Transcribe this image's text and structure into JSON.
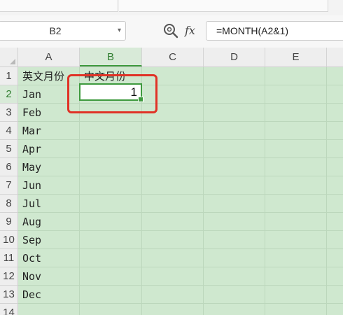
{
  "formula_bar": {
    "name_box": "B2",
    "name_box_arrow": "▾",
    "fx_label": "fx",
    "formula": "=MONTH(A2&1)"
  },
  "grid": {
    "columns": [
      "A",
      "B",
      "C",
      "D",
      "E"
    ],
    "active_column": "B",
    "rows": [
      "1",
      "2",
      "3",
      "4",
      "5",
      "6",
      "7",
      "8",
      "9",
      "10",
      "11",
      "12",
      "13",
      "14"
    ],
    "active_row": "2",
    "header_row": {
      "a1": "英文月份",
      "b1": "中文月份"
    },
    "months": [
      "Jan",
      "Feb",
      "Mar",
      "Apr",
      "May",
      "Jun",
      "Jul",
      "Aug",
      "Sep",
      "Oct",
      "Nov",
      "Dec"
    ],
    "b2_value": "1"
  },
  "colors": {
    "sheet_background": "#cfe8cf",
    "selection_border": "#3e9a3e",
    "highlight_box": "#e03226"
  },
  "icons": [
    "zoom-icon",
    "fx-icon",
    "name-box-dropdown-icon",
    "select-all-triangle-icon",
    "fill-handle-icon"
  ]
}
